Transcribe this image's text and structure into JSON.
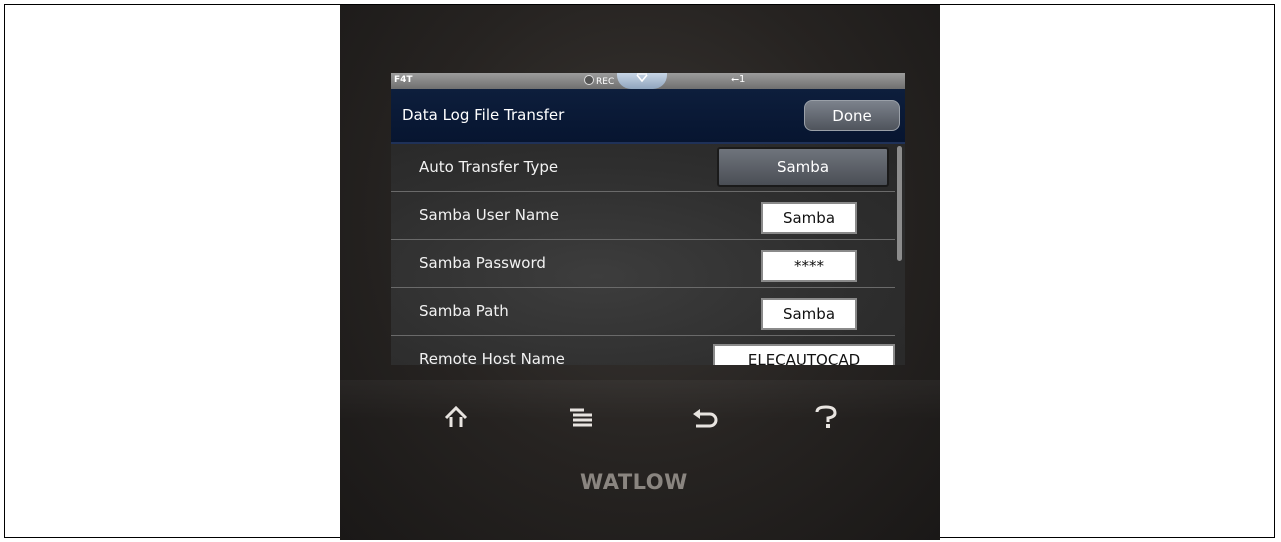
{
  "status_bar": {
    "model": "F4T",
    "rec_label": "REC",
    "usb_label": "1",
    "rec_icon": "record-dot-icon",
    "pulltab_icon": "chevron-down-icon",
    "usb_icon": "usb-icon"
  },
  "header": {
    "title": "Data Log File Transfer",
    "done_label": "Done"
  },
  "settings": [
    {
      "label": "Auto Transfer Type",
      "value": "Samba"
    },
    {
      "label": "Samba User Name",
      "value": "Samba"
    },
    {
      "label": "Samba Password",
      "value": "****"
    },
    {
      "label": "Samba Path",
      "value": "Samba"
    },
    {
      "label": "Remote Host Name",
      "value": "ELECAUTOCAD"
    }
  ],
  "nav_buttons": {
    "home_icon": "home-icon",
    "menu_icon": "menu-icon",
    "back_icon": "back-icon",
    "help_icon": "help-icon"
  },
  "brand": "WATLOW",
  "colors": {
    "title_bar": "#0d1e3c",
    "background": "#2e2e2e",
    "device": "#262321"
  }
}
